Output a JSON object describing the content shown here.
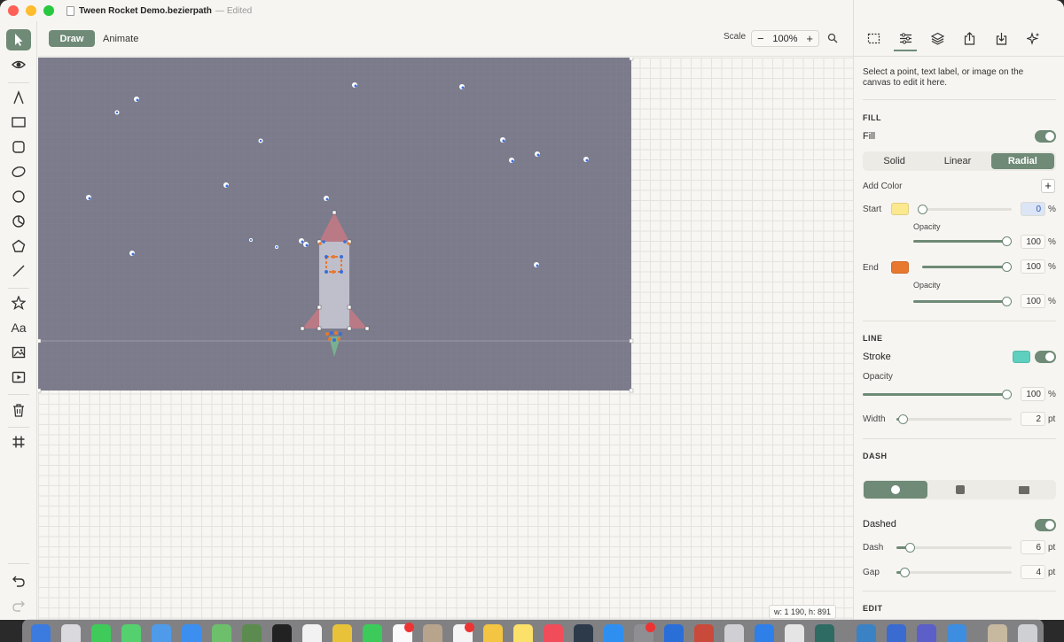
{
  "window": {
    "title": "Tween Rocket Demo.bezierpath",
    "separator": "—",
    "status": "Edited"
  },
  "tools": [
    {
      "name": "select-tool",
      "icon": "arrow-pointer-icon"
    },
    {
      "name": "preview-tool",
      "icon": "eye-icon"
    },
    {
      "name": "pen-tool",
      "icon": "pen-nib-icon"
    },
    {
      "name": "rectangle-tool",
      "icon": "rectangle-icon"
    },
    {
      "name": "rounded-rectangle-tool",
      "icon": "rounded-square-icon"
    },
    {
      "name": "ellipse-tool",
      "icon": "ellipse-icon"
    },
    {
      "name": "circle-tool",
      "icon": "circle-icon"
    },
    {
      "name": "pie-tool",
      "icon": "pie-icon"
    },
    {
      "name": "polygon-tool",
      "icon": "pentagon-icon"
    },
    {
      "name": "line-tool",
      "icon": "line-icon"
    },
    {
      "name": "star-tool",
      "icon": "star-icon"
    },
    {
      "name": "text-tool",
      "icon": "text-icon",
      "label": "Aa"
    },
    {
      "name": "image-tool",
      "icon": "image-icon"
    },
    {
      "name": "video-tool",
      "icon": "play-icon"
    },
    {
      "name": "delete-tool",
      "icon": "trash-icon"
    },
    {
      "name": "grid-tool",
      "icon": "hash-icon"
    }
  ],
  "modebar": {
    "draw_label": "Draw",
    "animate_label": "Animate",
    "scale_label": "Scale",
    "scale_minus": "−",
    "scale_value": "100%",
    "scale_plus": "+"
  },
  "canvas": {
    "size_readout": "w: 1 190, h: 891"
  },
  "inspector": {
    "hint": "Select a point, text label, or image on the canvas to edit it here.",
    "fill": {
      "section": "FILL",
      "label": "Fill",
      "enabled": true,
      "modes": [
        "Solid",
        "Linear",
        "Radial"
      ],
      "selected_mode": "Radial",
      "add_color_label": "Add Color",
      "add_color_button": "+",
      "start_label": "Start",
      "start_color": "#fbe88f",
      "start_position": "0",
      "start_position_unit": "%",
      "start_opacity_label": "Opacity",
      "start_opacity": "100",
      "start_opacity_unit": "%",
      "end_label": "End",
      "end_color": "#e8782e",
      "end_position": "100",
      "end_position_unit": "%",
      "end_opacity_label": "Opacity",
      "end_opacity": "100",
      "end_opacity_unit": "%"
    },
    "line": {
      "section": "LINE",
      "stroke_label": "Stroke",
      "stroke_color": "#5fcfbf",
      "stroke_enabled": true,
      "opacity_label": "Opacity",
      "opacity": "100",
      "opacity_unit": "%",
      "width_label": "Width",
      "width": "2",
      "width_unit": "pt"
    },
    "dash": {
      "section": "DASH",
      "cap_styles": [
        "round",
        "square",
        "butt"
      ],
      "selected_cap": "round",
      "dashed_label": "Dashed",
      "dashed_enabled": true,
      "dash_label": "Dash",
      "dash": "6",
      "dash_unit": "pt",
      "gap_label": "Gap",
      "gap": "4",
      "gap_unit": "pt"
    },
    "edit": {
      "section": "EDIT"
    }
  },
  "colors": {
    "accent": "#6f8a77",
    "artboard": "#7b7b8c",
    "rocket_body": "#bfbfcc",
    "rocket_fin": "#b97a86"
  }
}
